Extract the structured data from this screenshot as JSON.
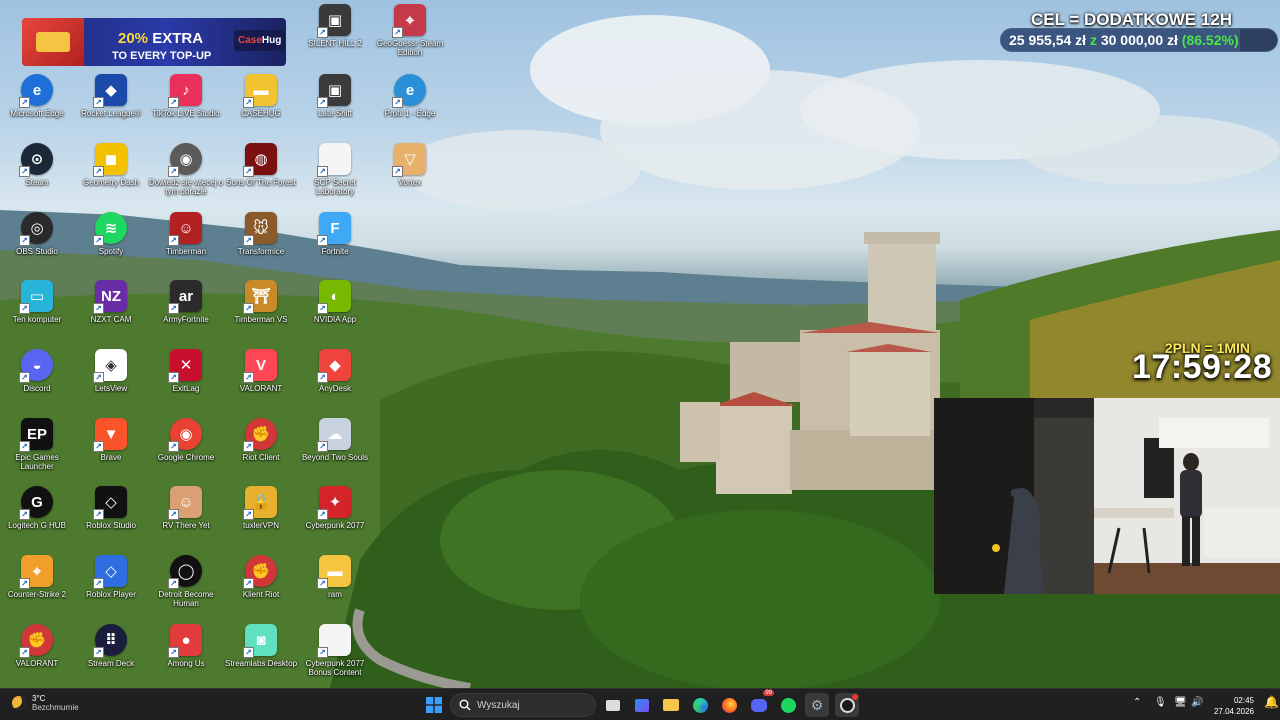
{
  "promo": {
    "percent": "20%",
    "extra": "EXTRA",
    "subtitle": "TO EVERY TOP-UP",
    "brand_a": "Case",
    "brand_b": "Hug"
  },
  "desktop_icons": [
    {
      "label": "Microsoft Edge"
    },
    {
      "label": "Rocket League®"
    },
    {
      "label": "TikTok LIVE Studio"
    },
    {
      "label": "CASEHUG"
    },
    {
      "label": "Late Shift"
    },
    {
      "label": "Profil 1 - Edge"
    },
    {
      "label": "Steam"
    },
    {
      "label": "Geometry Dash"
    },
    {
      "label": "Dowiedz się więcej o tym obrazie"
    },
    {
      "label": "Sons Of The Forest"
    },
    {
      "label": "SCP Secret Laboratory"
    },
    {
      "label": "Vortex"
    },
    {
      "label": "OBS Studio"
    },
    {
      "label": "Spotify"
    },
    {
      "label": "Timberman"
    },
    {
      "label": "Transformice"
    },
    {
      "label": "Fortnite"
    },
    {
      "label": "Ten komputer"
    },
    {
      "label": "NZXT CAM"
    },
    {
      "label": "ArmyFortnite"
    },
    {
      "label": "Timberman VS"
    },
    {
      "label": "NVIDIA App"
    },
    {
      "label": "Discord"
    },
    {
      "label": "LetsView"
    },
    {
      "label": "ExitLag"
    },
    {
      "label": "VALORANT"
    },
    {
      "label": "AnyDesk"
    },
    {
      "label": "Epic Games Launcher"
    },
    {
      "label": "Brave"
    },
    {
      "label": "Google Chrome"
    },
    {
      "label": "Riot Client"
    },
    {
      "label": "Beyond Two Souls"
    },
    {
      "label": "Logitech G HUB"
    },
    {
      "label": "Roblox Studio"
    },
    {
      "label": "RV There Yet"
    },
    {
      "label": "tuxlerVPN"
    },
    {
      "label": "Cyberpunk 2077"
    },
    {
      "label": "Counter-Strike 2"
    },
    {
      "label": "Roblox Player"
    },
    {
      "label": "Detroit Become Human"
    },
    {
      "label": "Klient Riot"
    },
    {
      "label": "ram"
    },
    {
      "label": "VALORANT"
    },
    {
      "label": "Stream Deck"
    },
    {
      "label": "Among Us"
    },
    {
      "label": "Streamlabs Desktop"
    },
    {
      "label": "Cyberpunk 2077 Bonus Content"
    },
    {
      "label": "SILENT HILL 2"
    },
    {
      "label": "GeoGuessr Steam Edition"
    }
  ],
  "overlay": {
    "goal_title": "CEL = DODATKOWE 12H",
    "goal_current": "25 955,54 zł",
    "goal_sep": "z",
    "goal_target": "30 000,00 zł",
    "goal_percent_text": "(86.52%)",
    "goal_fraction": 0.8652,
    "rate": "2PLN = 1MIN",
    "timer": "17:59:28"
  },
  "taskbar": {
    "weather_temp": "3°C",
    "weather_desc": "Bezchmurnie",
    "search_placeholder": "Wyszukaj",
    "time": "02:45",
    "date": "27.04.2026",
    "discord_badge": "99"
  }
}
